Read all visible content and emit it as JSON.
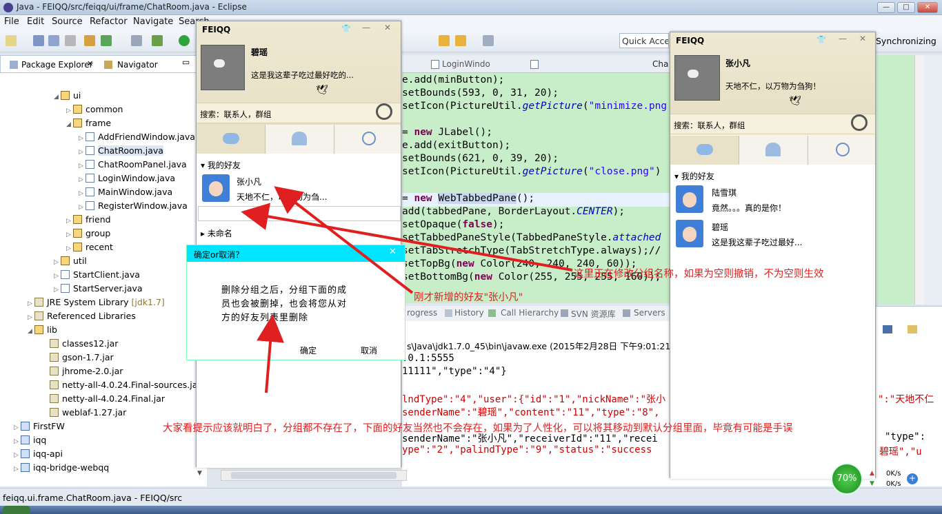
{
  "window": {
    "title": "Java - FEIQQ/src/feiqq/ui/frame/ChatRoom.java - Eclipse"
  },
  "menu": [
    "File",
    "Edit",
    "Source",
    "Refactor",
    "Navigate",
    "Search",
    "Project",
    "Run",
    "Window",
    "Help"
  ],
  "toolbar": {
    "quick_access": "Quick Access",
    "synchronizing": "Synchronizing"
  },
  "panel_tabs": {
    "package_explorer": "Package Explorer",
    "navigator": "Navigator"
  },
  "tree": {
    "items": [
      {
        "label": "ui"
      },
      {
        "label": "common"
      },
      {
        "label": "frame"
      },
      {
        "label": "AddFriendWindow.java"
      },
      {
        "label": "ChatRoom.java"
      },
      {
        "label": "ChatRoomPanel.java"
      },
      {
        "label": "LoginWindow.java"
      },
      {
        "label": "MainWindow.java"
      },
      {
        "label": "RegisterWindow.java"
      },
      {
        "label": "friend"
      },
      {
        "label": "group"
      },
      {
        "label": "recent"
      },
      {
        "label": "util"
      },
      {
        "label": "StartClient.java"
      },
      {
        "label": "StartServer.java"
      },
      {
        "label": "JRE System Library"
      },
      {
        "label": "Referenced Libraries"
      },
      {
        "label": "lib"
      },
      {
        "label": "classes12.jar"
      },
      {
        "label": "gson-1.7.jar"
      },
      {
        "label": "jhrome-2.0.jar"
      },
      {
        "label": "netty-all-4.0.24.Final-sources.jar"
      },
      {
        "label": "netty-all-4.0.24.Final.jar"
      },
      {
        "label": "weblaf-1.27.jar"
      },
      {
        "label": "FirstFW"
      },
      {
        "label": "iqq"
      },
      {
        "label": "iqq-api"
      },
      {
        "label": "iqq-bridge-webqq"
      }
    ],
    "jre_tag": "[jdk1.7]"
  },
  "editor_tabs": [
    "LoginWindo",
    "Cha"
  ],
  "code": {
    "l1": "e.add(minButton);",
    "l2": "setBounds(593, 0, 31, 20);",
    "l3a": "setIcon(PictureUtil.",
    "l3b": "getPicture",
    "l3c": "(",
    "l3d": "\"minimize.png",
    "l4a": "= ",
    "l4b": "new",
    "l4c": " JLabel();",
    "l5": "e.add(exitButton);",
    "l6": "setBounds(621, 0, 39, 20);",
    "l7a": "setIcon(PictureUtil.",
    "l7b": "getPicture",
    "l7c": "(",
    "l7d": "\"close.png\"",
    "l7e": ")",
    "l8a": "= ",
    "l8b": "new",
    "l8c": " ",
    "l8d": "WebTabbedPane",
    "l8e": "();",
    "l9a": "add(tabbedPane, BorderLayout.",
    "l9b": "CENTER",
    "l9c": ");",
    "l10a": "setOpaque(",
    "l10b": "false",
    "l10c": ");",
    "l11a": "setTabbedPaneStyle(TabbedPaneStyle.",
    "l11b": "attached",
    "l12": "setTabStretchType(TabStretchType.always);//",
    "l13a": "setTopBg(",
    "l13b": "new",
    "l13c": " Color(240, 240, 240, 60));",
    "l14a": "setBottomBg(",
    "l14b": "new",
    "l14c": " Color(255, 255, 255, 160));"
  },
  "console": {
    "tabs": [
      "rogress",
      "History",
      "Call Hierarchy",
      "SVN 资源库",
      "Servers"
    ],
    "path": "s\\Java\\jdk1.7.0_45\\bin\\javaw.exe (2015年2月28日 下午9:01:21)",
    "l1": ".0.1:5555",
    "l2": "11111\",\"type\":\"4\"}",
    "l3": "lndType\":\"4\",\"user\":{\"id\":\"1\",\"nickName\":\"张小",
    "l3r": "\":\"天地不仁",
    "l4": "senderName\":\"碧瑶\",\"content\":\"11\",\"type\":\"8\",",
    "l5": "senderName\":\"张小凡\",\"receiverId\":\"11\",\"recei",
    "l5r": "\"type\":",
    "l6": "ype\":\"2\",\"palindType\":\"9\",\"status\":\"success",
    "l6r": "碧瑶\",\"u"
  },
  "status": {
    "left": "feiqq.ui.frame.ChatRoom.java - FEIQQ/src"
  },
  "qq1": {
    "title": "FEIQQ",
    "name": "碧瑶",
    "motto": "这是我这辈子吃过最好吃的...",
    "search": "搜索：联系人，群组",
    "group_open": "我的好友",
    "group_closed": "未命名",
    "friend": {
      "name": "张小凡",
      "motto": "天地不仁，以万物为刍..."
    }
  },
  "qq2": {
    "title": "FEIQQ",
    "name": "张小凡",
    "motto": "天地不仁，以万物为刍狗！",
    "search": "搜索：联系人，群组",
    "group_open": "我的好友",
    "friends": [
      {
        "name": "陆雪琪",
        "motto": "竟然。。。真的是你！"
      },
      {
        "name": "碧瑶",
        "motto": "这是我这辈子吃过最好..."
      }
    ]
  },
  "dialog": {
    "title": "确定or取消？",
    "message_l1": "删除分组之后，分组下面的成",
    "message_l2": "员也会被删掉，也会将您从对",
    "message_l3": "方的好友列表里删除",
    "ok": "确定",
    "cancel": "取消"
  },
  "annotations": {
    "a1": "这里正在修改分组名称，如果为空则撤销，不为空则生效",
    "a2": "刚才新增的好友\"张小凡\"",
    "a3": "大家看提示应该就明白了，分组都不存在了，下面的好友当然也不会存在，如果为了人性化，可以将其移动到默认分组里面，毕竟有可能是手误"
  },
  "net": {
    "percent": "70%",
    "up": "0K/s",
    "down": "0K/s"
  },
  "colors": {
    "accent": "#00e5ff",
    "annotation": "#e02020"
  }
}
